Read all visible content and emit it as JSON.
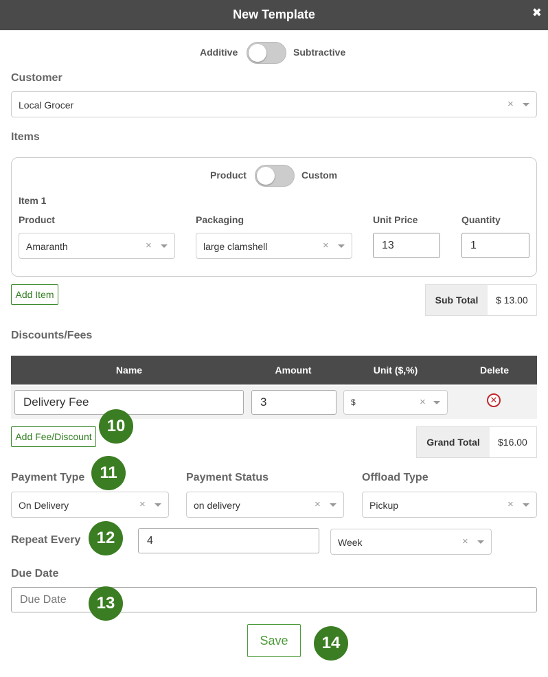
{
  "modal": {
    "title": "New Template",
    "close": "✖"
  },
  "mode_toggle": {
    "left": "Additive",
    "right": "Subtractive"
  },
  "customer": {
    "label": "Customer",
    "value": "Local Grocer"
  },
  "items": {
    "label": "Items",
    "toggle": {
      "left": "Product",
      "right": "Custom"
    },
    "item_label": "Item 1",
    "product_label": "Product",
    "product_value": "Amaranth",
    "packaging_label": "Packaging",
    "packaging_value": "large clamshell",
    "unit_price_label": "Unit Price",
    "unit_price_value": "13",
    "quantity_label": "Quantity",
    "quantity_value": "1",
    "add_item": "Add Item"
  },
  "subtotal": {
    "label": "Sub Total",
    "value": "$ 13.00"
  },
  "fees": {
    "label": "Discounts/Fees",
    "columns": [
      "Name",
      "Amount",
      "Unit ($,%)",
      "Delete"
    ],
    "row": {
      "name": "Delivery Fee",
      "amount": "3",
      "unit": "$"
    },
    "add": "Add Fee/Discount"
  },
  "grandtotal": {
    "label": "Grand Total",
    "value": "$16.00"
  },
  "payment_type": {
    "label": "Payment Type",
    "value": "On Delivery"
  },
  "payment_status": {
    "label": "Payment Status",
    "value": "on delivery"
  },
  "offload_type": {
    "label": "Offload Type",
    "value": "Pickup"
  },
  "repeat": {
    "label": "Repeat Every",
    "value": "4",
    "unit": "Week"
  },
  "due_date": {
    "label": "Due Date",
    "placeholder": "Due Date"
  },
  "save": "Save",
  "badges": [
    "10",
    "11",
    "12",
    "13",
    "14"
  ],
  "icons": {
    "clear": "×"
  },
  "colors": {
    "header_bg": "#4a4a4a",
    "accent_green": "#3b7d22",
    "delete_red": "#c0282d"
  }
}
